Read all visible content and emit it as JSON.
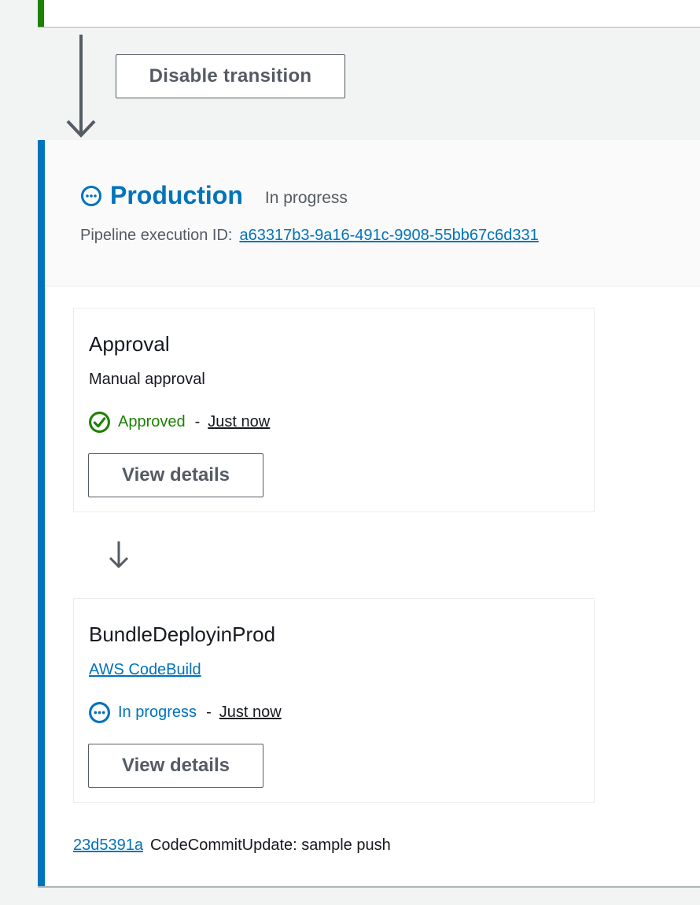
{
  "transition": {
    "disable_label": "Disable transition"
  },
  "stage": {
    "name": "Production",
    "status": "In progress",
    "execution_label": "Pipeline execution ID:",
    "execution_id": "a63317b3-9a16-491c-9908-55bb67c6d331",
    "accent_color": "#0073bb"
  },
  "actions": [
    {
      "name": "Approval",
      "provider": "Manual approval",
      "status": "Approved",
      "status_color": "#1d8102",
      "status_icon": "check-circle-icon",
      "dash": "-",
      "time": "Just now",
      "button": "View details"
    },
    {
      "name": "BundleDeployinProd",
      "provider": "AWS CodeBuild",
      "status": "In progress",
      "status_color": "#0073bb",
      "status_icon": "in-progress-icon",
      "dash": "-",
      "time": "Just now",
      "button": "View details"
    }
  ],
  "commit": {
    "id": "23d5391a",
    "message": "CodeCommitUpdate: sample push"
  },
  "colors": {
    "success": "#1d8102",
    "link": "#0073bb",
    "button_text": "#545b64"
  }
}
